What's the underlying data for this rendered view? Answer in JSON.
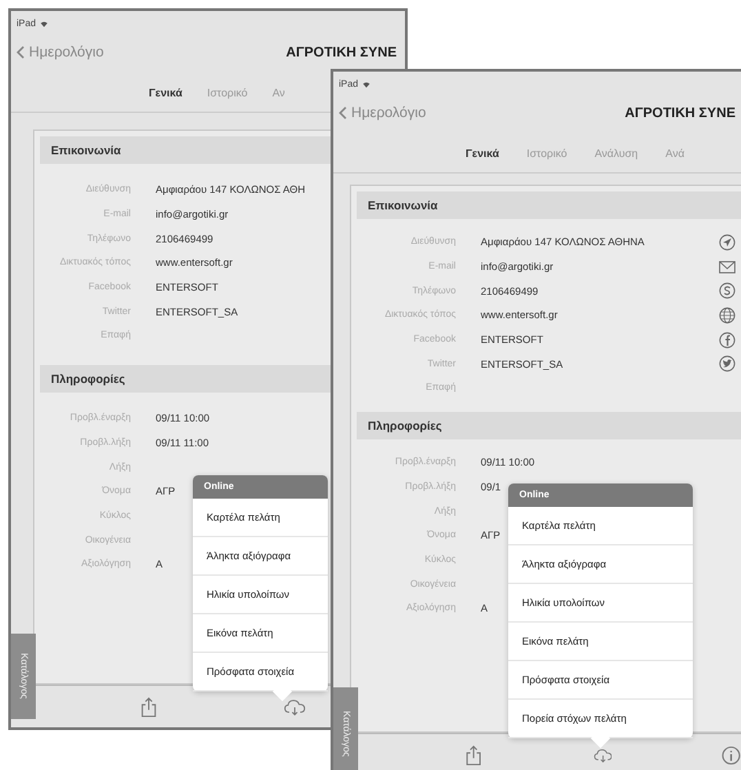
{
  "screens": [
    {
      "status": "iPad",
      "back_link": "Ημερολόγιο",
      "title": "ΑΓΡΟΤΙΚΗ ΣΥΝΕ",
      "tabs": [
        {
          "label": "Γενικά",
          "selected": true
        },
        {
          "label": "Ιστορικό",
          "selected": false
        },
        {
          "label": "Αν",
          "selected": false
        }
      ],
      "sections": [
        {
          "title": "Επικοινωνία",
          "rows": [
            {
              "label": "Διεύθυνση",
              "value": "Αμφιαράου 147 ΚΟΛΩΝΟΣ ΑΘΗ"
            },
            {
              "label": "E-mail",
              "value": "info@argotiki.gr"
            },
            {
              "label": "Τηλέφωνο",
              "value": "2106469499"
            },
            {
              "label": "Δικτυακός τόπος",
              "value": "www.entersoft.gr"
            },
            {
              "label": "Facebook",
              "value": "ENTERSOFT"
            },
            {
              "label": "Twitter",
              "value": "ENTERSOFT_SA"
            },
            {
              "label": "Επαφή"
            }
          ]
        },
        {
          "title": "Πληροφορίες",
          "rows": [
            {
              "label": "Προβλ.έναρξη",
              "value": "09/11 10:00"
            },
            {
              "label": "Προβλ.λήξη",
              "value": "09/11 11:00"
            },
            {
              "label": "Λήξη"
            },
            {
              "label": "Όνομα",
              "value": "ΑΓΡ"
            },
            {
              "label": "Κύκλος"
            },
            {
              "label": "Οικογένεια"
            },
            {
              "label": "Αξιολόγηση",
              "value": "Α"
            }
          ]
        }
      ],
      "popup": {
        "header": "Online",
        "items": [
          "Καρτέλα πελάτη",
          "Άληκτα αξιόγραφα",
          "Ηλικία υπολοίπων",
          "Εικόνα πελάτη",
          "Πρόσφατα στοιχεία"
        ]
      },
      "toolbar": [
        {
          "kind": "share"
        },
        {
          "kind": "cloud"
        }
      ],
      "side_tab": "Κατάλογος"
    },
    {
      "status": "iPad",
      "back_link": "Ημερολόγιο",
      "title": "ΑΓΡΟΤΙΚΗ ΣΥΝΕ",
      "tabs": [
        {
          "label": "Γενικά",
          "selected": true
        },
        {
          "label": "Ιστορικό",
          "selected": false
        },
        {
          "label": "Ανάλυση",
          "selected": false
        },
        {
          "label": "Ανά",
          "selected": false
        }
      ],
      "sections": [
        {
          "title": "Επικοινωνία",
          "rows": [
            {
              "label": "Διεύθυνση",
              "value": "Αμφιαράου 147 ΚΟΛΩΝΟΣ ΑΘΗΝΑ",
              "kind": "location"
            },
            {
              "label": "E-mail",
              "value": "info@argotiki.gr",
              "kind": "mail"
            },
            {
              "label": "Τηλέφωνο",
              "value": "2106469499",
              "kind": "skype"
            },
            {
              "label": "Δικτυακός τόπος",
              "value": "www.entersoft.gr",
              "kind": "globe"
            },
            {
              "label": "Facebook",
              "value": "ENTERSOFT",
              "kind": "facebook"
            },
            {
              "label": "Twitter",
              "value": "ENTERSOFT_SA",
              "kind": "twitter"
            },
            {
              "label": "Επαφή"
            }
          ]
        },
        {
          "title": "Πληροφορίες",
          "rows": [
            {
              "label": "Προβλ.έναρξη",
              "value": "09/11 10:00"
            },
            {
              "label": "Προβλ.λήξη",
              "value": "09/1"
            },
            {
              "label": "Λήξη"
            },
            {
              "label": "Όνομα",
              "value": "ΑΓΡ"
            },
            {
              "label": "Κύκλος"
            },
            {
              "label": "Οικογένεια"
            },
            {
              "label": "Αξιολόγηση",
              "value": "Α"
            }
          ]
        }
      ],
      "popup": {
        "header": "Online",
        "items": [
          "Καρτέλα πελάτη",
          "Άληκτα αξιόγραφα",
          "Ηλικία υπολοίπων",
          "Εικόνα πελάτη",
          "Πρόσφατα στοιχεία",
          "Πορεία στόχων πελάτη"
        ]
      },
      "toolbar": [
        {
          "kind": "share"
        },
        {
          "kind": "cloud"
        },
        {
          "kind": "info"
        }
      ],
      "side_tab": "Κατάλογος"
    }
  ]
}
